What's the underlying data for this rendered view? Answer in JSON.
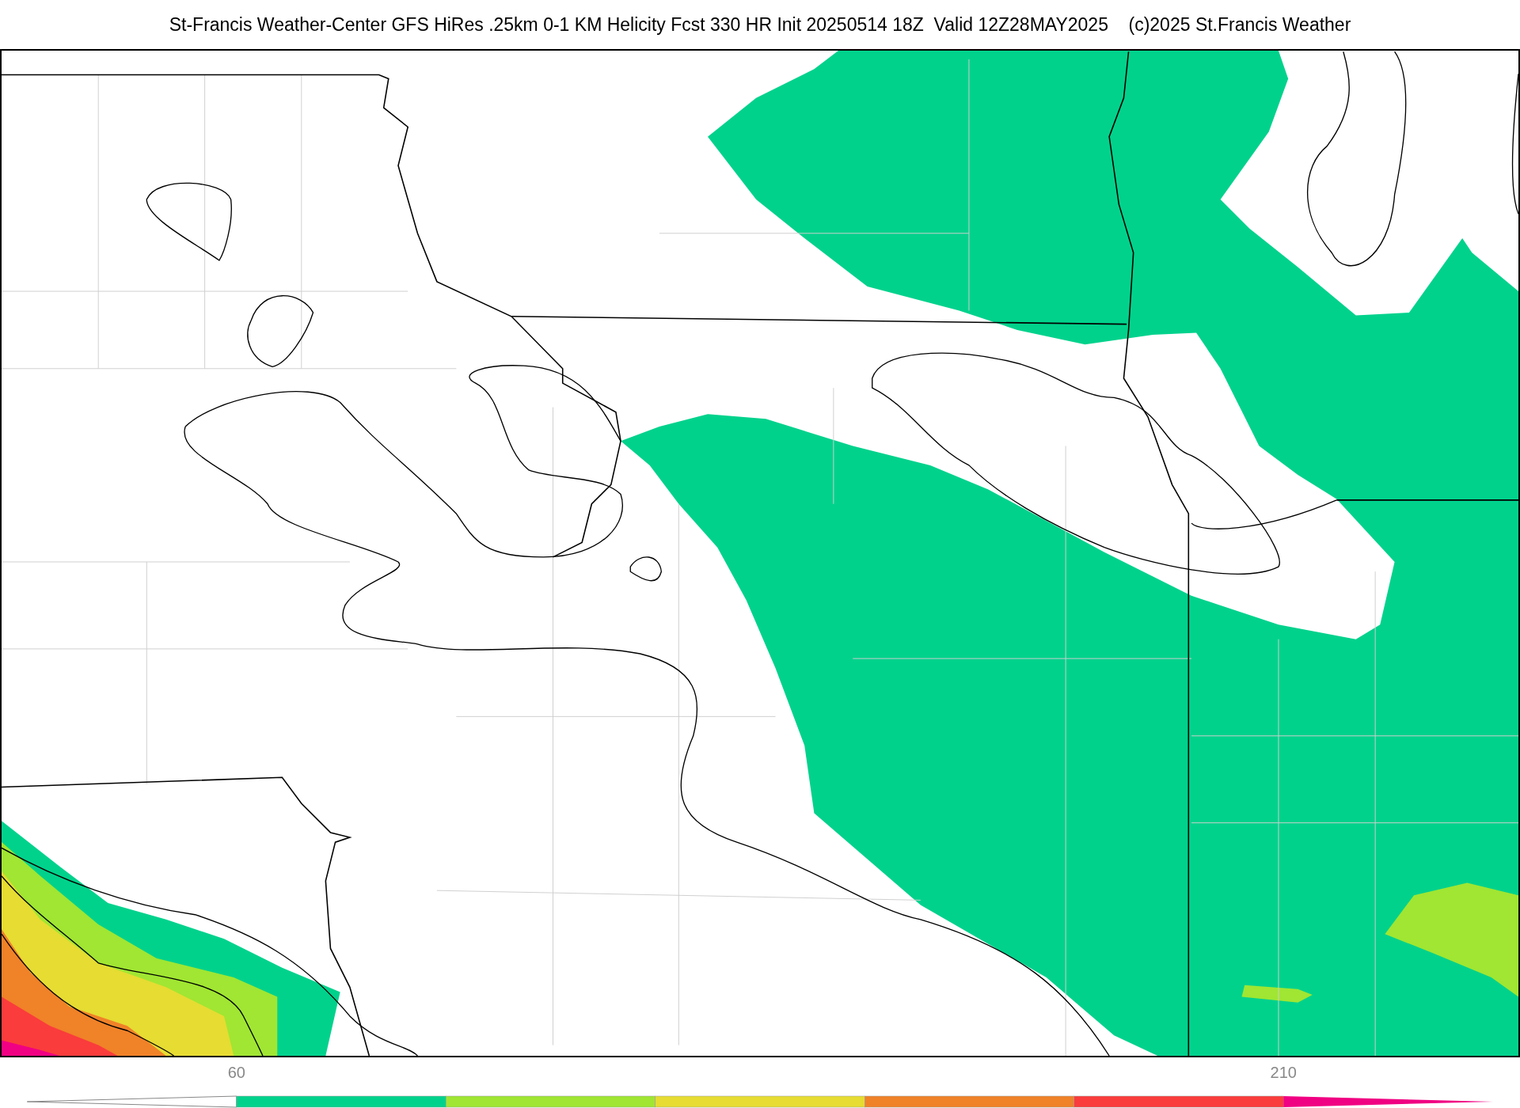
{
  "title": "St-Francis Weather-Center GFS HiRes .25km 0-1 KM Helicity Fcst 330 HR Init 20250514 18Z  Valid 12Z28MAY2025    (c)2025 St.Francis Weather",
  "colorbar": {
    "ticks": [
      {
        "label": "60"
      },
      {
        "label": "210"
      }
    ],
    "segments": [
      {
        "kind": "under",
        "color": "#ffffff"
      },
      {
        "kind": "bar",
        "color": "#00d28c"
      },
      {
        "kind": "bar",
        "color": "#a0e632"
      },
      {
        "kind": "bar",
        "color": "#e6dc32"
      },
      {
        "kind": "bar",
        "color": "#f08228"
      },
      {
        "kind": "bar",
        "color": "#fa3c3c"
      },
      {
        "kind": "over",
        "color": "#f00082"
      }
    ]
  }
}
